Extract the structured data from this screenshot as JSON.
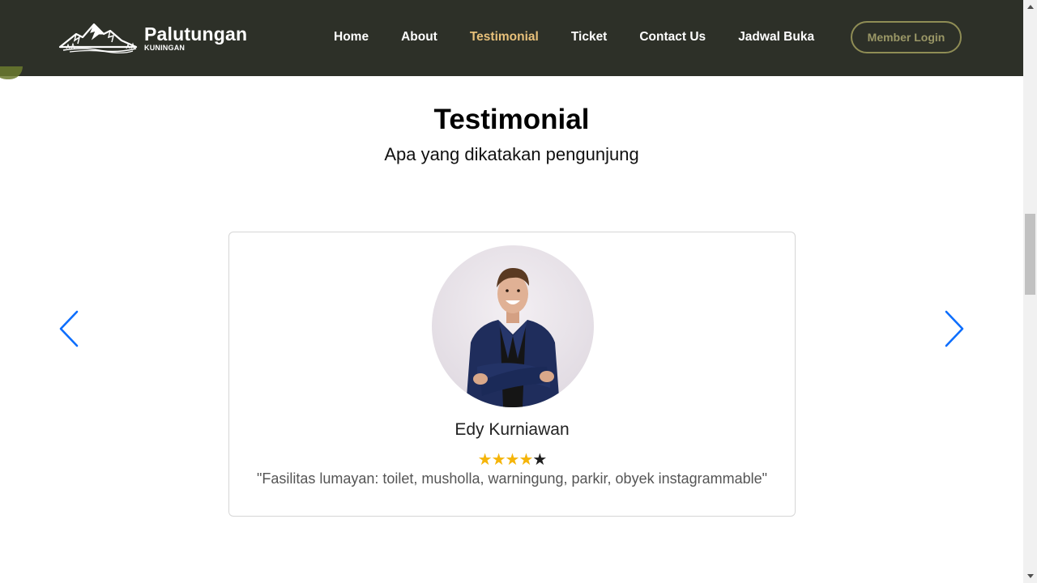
{
  "brand": {
    "name": "Palutungan",
    "subtitle": "KUNINGAN",
    "logo_icon": "mountain-icon"
  },
  "nav": {
    "items": [
      {
        "label": "Home",
        "active": false
      },
      {
        "label": "About",
        "active": false
      },
      {
        "label": "Testimonial",
        "active": true
      },
      {
        "label": "Ticket",
        "active": false
      },
      {
        "label": "Contact Us",
        "active": false
      },
      {
        "label": "Jadwal Buka",
        "active": false
      }
    ],
    "login_label": "Member Login"
  },
  "section": {
    "title": "Testimonial",
    "subtitle": "Apa yang dikatakan pengunjung"
  },
  "testimonial": {
    "name": "Edy Kurniawan",
    "rating": 4,
    "rating_max": 5,
    "quote": "\"Fasilitas lumayan: toilet, musholla, warningung, parkir, obyek instagrammable\"",
    "avatar_icon": "person-avatar"
  },
  "carousel": {
    "prev_icon": "chevron-left-icon",
    "next_icon": "chevron-right-icon"
  },
  "colors": {
    "header_bg": "#2d3028",
    "nav_active": "#e7c07a",
    "login_border": "#8f8d55",
    "star_filled": "#f5b50a",
    "arrow": "#0d6efd"
  }
}
